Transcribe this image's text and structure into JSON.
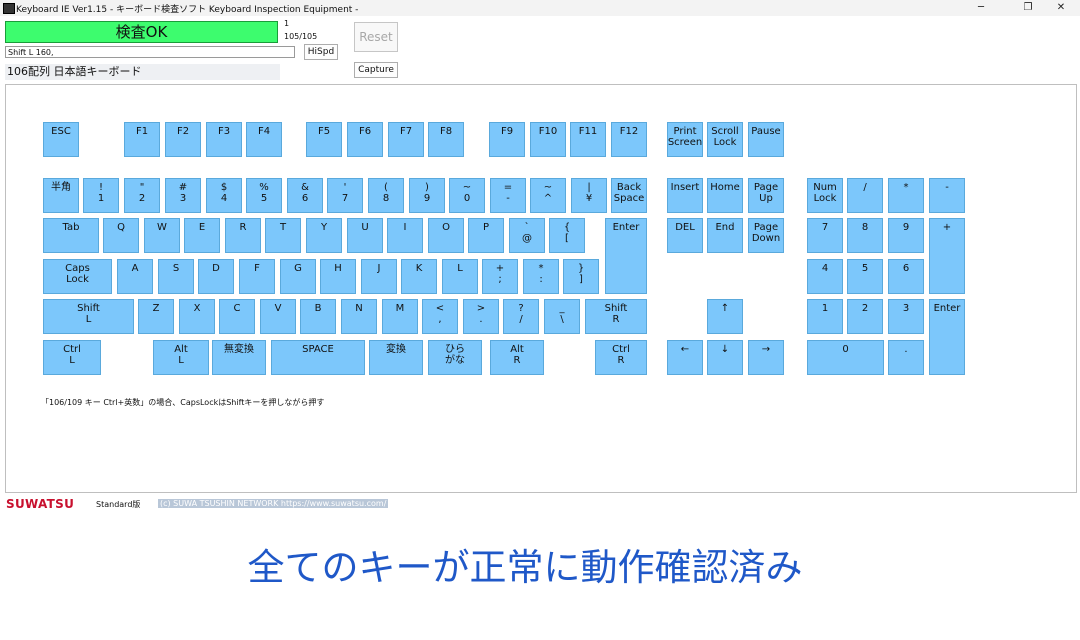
{
  "window": {
    "title": "Keyboard IE Ver1.15 - キーボード検査ソフト Keyboard Inspection Equipment -",
    "minimize": "─",
    "restore": "❐",
    "close": "✕"
  },
  "status": {
    "result": "検査OK",
    "count_top": "1",
    "count_bottom": "105/105",
    "input_value": "Shift L 160,",
    "hispd_label": "HiSpd",
    "reset_label": "Reset",
    "capture_label": "Capture",
    "layout_label": "106配列 日本語キーボード"
  },
  "colors": {
    "key_ok": "#7cc7fb",
    "status_ok": "#3dfc6e",
    "caption": "#1f58c8",
    "brand": "#c8102e"
  },
  "keys": [
    {
      "id": "esc",
      "l1": "ESC",
      "l2": ""
    },
    {
      "id": "f1",
      "l1": "F1",
      "l2": ""
    },
    {
      "id": "f2",
      "l1": "F2",
      "l2": ""
    },
    {
      "id": "f3",
      "l1": "F3",
      "l2": ""
    },
    {
      "id": "f4",
      "l1": "F4",
      "l2": ""
    },
    {
      "id": "f5",
      "l1": "F5",
      "l2": ""
    },
    {
      "id": "f6",
      "l1": "F6",
      "l2": ""
    },
    {
      "id": "f7",
      "l1": "F7",
      "l2": ""
    },
    {
      "id": "f8",
      "l1": "F8",
      "l2": ""
    },
    {
      "id": "f9",
      "l1": "F9",
      "l2": ""
    },
    {
      "id": "f10",
      "l1": "F10",
      "l2": ""
    },
    {
      "id": "f11",
      "l1": "F11",
      "l2": ""
    },
    {
      "id": "f12",
      "l1": "F12",
      "l2": ""
    },
    {
      "id": "print-screen",
      "l1": "Print",
      "l2": "Screen"
    },
    {
      "id": "scroll-lock",
      "l1": "Scroll",
      "l2": "Lock"
    },
    {
      "id": "pause",
      "l1": "Pause",
      "l2": ""
    },
    {
      "id": "hankaku",
      "l1": "半角",
      "l2": ""
    },
    {
      "id": "1",
      "l1": "!",
      "l2": "1"
    },
    {
      "id": "2",
      "l1": "\"",
      "l2": "2"
    },
    {
      "id": "3",
      "l1": "#",
      "l2": "3"
    },
    {
      "id": "4",
      "l1": "$",
      "l2": "4"
    },
    {
      "id": "5",
      "l1": "%",
      "l2": "5"
    },
    {
      "id": "6",
      "l1": "&",
      "l2": "6"
    },
    {
      "id": "7",
      "l1": "'",
      "l2": "7"
    },
    {
      "id": "8",
      "l1": "(",
      "l2": "8"
    },
    {
      "id": "9",
      "l1": ")",
      "l2": "9"
    },
    {
      "id": "0",
      "l1": "~",
      "l2": "0"
    },
    {
      "id": "minus",
      "l1": "=",
      "l2": "-"
    },
    {
      "id": "caret",
      "l1": "~",
      "l2": "^"
    },
    {
      "id": "yen",
      "l1": "|",
      "l2": "¥"
    },
    {
      "id": "backspace",
      "l1": "Back",
      "l2": "Space"
    },
    {
      "id": "insert",
      "l1": "Insert",
      "l2": ""
    },
    {
      "id": "home",
      "l1": "Home",
      "l2": ""
    },
    {
      "id": "page-up",
      "l1": "Page",
      "l2": "Up"
    },
    {
      "id": "num-lock",
      "l1": "Num",
      "l2": "Lock"
    },
    {
      "id": "num-slash",
      "l1": "/",
      "l2": ""
    },
    {
      "id": "num-star",
      "l1": "*",
      "l2": ""
    },
    {
      "id": "num-minus",
      "l1": "-",
      "l2": ""
    },
    {
      "id": "tab",
      "l1": "Tab",
      "l2": ""
    },
    {
      "id": "q",
      "l1": "Q",
      "l2": ""
    },
    {
      "id": "w",
      "l1": "W",
      "l2": ""
    },
    {
      "id": "e",
      "l1": "E",
      "l2": ""
    },
    {
      "id": "r",
      "l1": "R",
      "l2": ""
    },
    {
      "id": "t",
      "l1": "T",
      "l2": ""
    },
    {
      "id": "y",
      "l1": "Y",
      "l2": ""
    },
    {
      "id": "u",
      "l1": "U",
      "l2": ""
    },
    {
      "id": "i",
      "l1": "I",
      "l2": ""
    },
    {
      "id": "o",
      "l1": "O",
      "l2": ""
    },
    {
      "id": "p",
      "l1": "P",
      "l2": ""
    },
    {
      "id": "at",
      "l1": "`",
      "l2": "@"
    },
    {
      "id": "bracket-open",
      "l1": "{",
      "l2": "["
    },
    {
      "id": "enter",
      "l1": "Enter",
      "l2": ""
    },
    {
      "id": "delete",
      "l1": "DEL",
      "l2": ""
    },
    {
      "id": "end",
      "l1": "End",
      "l2": ""
    },
    {
      "id": "page-down",
      "l1": "Page",
      "l2": "Down"
    },
    {
      "id": "num-7",
      "l1": "7",
      "l2": ""
    },
    {
      "id": "num-8",
      "l1": "8",
      "l2": ""
    },
    {
      "id": "num-9",
      "l1": "9",
      "l2": ""
    },
    {
      "id": "num-plus",
      "l1": "+",
      "l2": ""
    },
    {
      "id": "caps-lock",
      "l1": "Caps",
      "l2": "Lock"
    },
    {
      "id": "a",
      "l1": "A",
      "l2": ""
    },
    {
      "id": "s",
      "l1": "S",
      "l2": ""
    },
    {
      "id": "d",
      "l1": "D",
      "l2": ""
    },
    {
      "id": "f",
      "l1": "F",
      "l2": ""
    },
    {
      "id": "g",
      "l1": "G",
      "l2": ""
    },
    {
      "id": "h",
      "l1": "H",
      "l2": ""
    },
    {
      "id": "j",
      "l1": "J",
      "l2": ""
    },
    {
      "id": "k",
      "l1": "K",
      "l2": ""
    },
    {
      "id": "l",
      "l1": "L",
      "l2": ""
    },
    {
      "id": "semicolon",
      "l1": "+",
      "l2": ";"
    },
    {
      "id": "colon",
      "l1": "*",
      "l2": ":"
    },
    {
      "id": "bracket-close",
      "l1": "}",
      "l2": "]"
    },
    {
      "id": "num-4",
      "l1": "4",
      "l2": ""
    },
    {
      "id": "num-5",
      "l1": "5",
      "l2": ""
    },
    {
      "id": "num-6",
      "l1": "6",
      "l2": ""
    },
    {
      "id": "shift-l",
      "l1": "Shift",
      "l2": "L"
    },
    {
      "id": "z",
      "l1": "Z",
      "l2": ""
    },
    {
      "id": "x",
      "l1": "X",
      "l2": ""
    },
    {
      "id": "c",
      "l1": "C",
      "l2": ""
    },
    {
      "id": "v",
      "l1": "V",
      "l2": ""
    },
    {
      "id": "b",
      "l1": "B",
      "l2": ""
    },
    {
      "id": "n",
      "l1": "N",
      "l2": ""
    },
    {
      "id": "m",
      "l1": "M",
      "l2": ""
    },
    {
      "id": "comma",
      "l1": "<",
      "l2": ","
    },
    {
      "id": "period",
      "l1": ">",
      "l2": "."
    },
    {
      "id": "slash",
      "l1": "?",
      "l2": "/"
    },
    {
      "id": "backslash",
      "l1": "_",
      "l2": "\\"
    },
    {
      "id": "shift-r",
      "l1": "Shift",
      "l2": "R"
    },
    {
      "id": "arrow-up",
      "l1": "↑",
      "l2": ""
    },
    {
      "id": "num-1",
      "l1": "1",
      "l2": ""
    },
    {
      "id": "num-2",
      "l1": "2",
      "l2": ""
    },
    {
      "id": "num-3",
      "l1": "3",
      "l2": ""
    },
    {
      "id": "num-enter",
      "l1": "Enter",
      "l2": ""
    },
    {
      "id": "ctrl-l",
      "l1": "Ctrl",
      "l2": "L"
    },
    {
      "id": "alt-l",
      "l1": "Alt",
      "l2": "L"
    },
    {
      "id": "muhenkan",
      "l1": "無変換",
      "l2": ""
    },
    {
      "id": "space",
      "l1": "SPACE",
      "l2": ""
    },
    {
      "id": "henkan",
      "l1": "変換",
      "l2": ""
    },
    {
      "id": "hiragana",
      "l1": "ひら",
      "l2": "がな"
    },
    {
      "id": "alt-r",
      "l1": "Alt",
      "l2": "R"
    },
    {
      "id": "ctrl-r",
      "l1": "Ctrl",
      "l2": "R"
    },
    {
      "id": "arrow-left",
      "l1": "←",
      "l2": ""
    },
    {
      "id": "arrow-down",
      "l1": "↓",
      "l2": ""
    },
    {
      "id": "arrow-right",
      "l1": "→",
      "l2": ""
    },
    {
      "id": "num-0",
      "l1": "0",
      "l2": ""
    },
    {
      "id": "num-dot",
      "l1": ".",
      "l2": ""
    }
  ],
  "note": "「106/109 キー Ctrl+英数」の場合、CapsLockはShiftキーを押しながら押す",
  "footer": {
    "brand": "SUWATSU",
    "edition": "Standard版",
    "copyright": "(c) SUWA TSUSHIN NETWORK  https://www.suwatsu.com/"
  },
  "caption": "全てのキーが正常に動作確認済み"
}
